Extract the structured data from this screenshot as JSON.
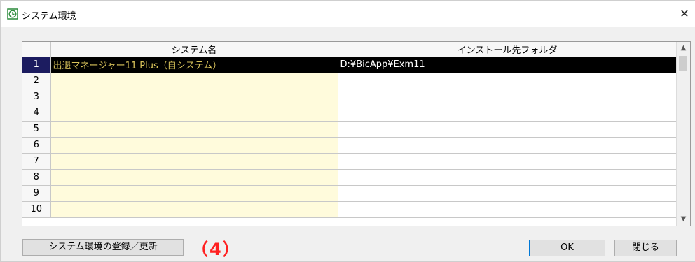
{
  "window": {
    "title": "システム環境",
    "close_glyph": "✕"
  },
  "grid": {
    "columns": [
      "",
      "システム名",
      "インストール先フォルダ"
    ],
    "rows": [
      {
        "num": "1",
        "name": "出退マネージャー11 Plus（自システム）",
        "folder": "D:¥BicApp¥Exm11"
      },
      {
        "num": "2",
        "name": "",
        "folder": ""
      },
      {
        "num": "3",
        "name": "",
        "folder": ""
      },
      {
        "num": "4",
        "name": "",
        "folder": ""
      },
      {
        "num": "5",
        "name": "",
        "folder": ""
      },
      {
        "num": "6",
        "name": "",
        "folder": ""
      },
      {
        "num": "7",
        "name": "",
        "folder": ""
      },
      {
        "num": "8",
        "name": "",
        "folder": ""
      },
      {
        "num": "9",
        "name": "",
        "folder": ""
      },
      {
        "num": "10",
        "name": "",
        "folder": ""
      }
    ],
    "selected_row": "1"
  },
  "buttons": {
    "register": "システム環境の登録／更新",
    "ok": "OK",
    "close": "閉じる"
  },
  "annotation": "（4）",
  "colors": {
    "selected_bg": "#000000",
    "selected_name_text": "#d8c25a",
    "name_column_bg": "#fffbdc",
    "annotation": "#ff2020"
  }
}
